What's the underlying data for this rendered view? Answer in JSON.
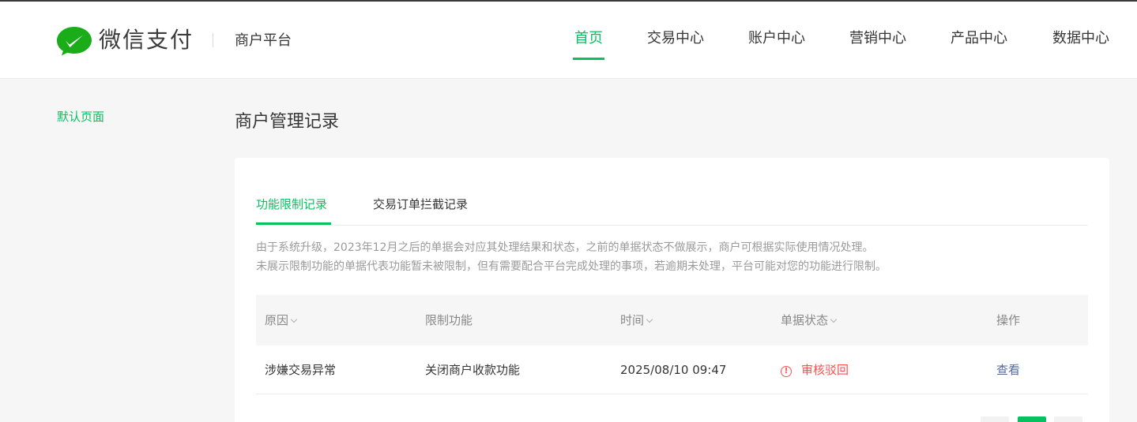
{
  "header": {
    "brand": "微信支付",
    "platform": "商户平台",
    "nav": [
      {
        "label": "首页",
        "active": true
      },
      {
        "label": "交易中心",
        "active": false
      },
      {
        "label": "账户中心",
        "active": false
      },
      {
        "label": "营销中心",
        "active": false
      },
      {
        "label": "产品中心",
        "active": false
      },
      {
        "label": "数据中心",
        "active": false
      }
    ]
  },
  "sidebar": {
    "link": "默认页面"
  },
  "page": {
    "title": "商户管理记录"
  },
  "tabs": [
    {
      "label": "功能限制记录",
      "active": true
    },
    {
      "label": "交易订单拦截记录",
      "active": false
    }
  ],
  "notice": {
    "line1": "由于系统升级，2023年12月之后的单据会对应其处理结果和状态，之前的单据状态不做展示，商户可根据实际使用情况处理。",
    "line2": "未展示限制功能的单据代表功能暂未被限制，但有需要配合平台完成处理的事项，若逾期未处理，平台可能对您的功能进行限制。"
  },
  "table": {
    "headers": [
      "原因",
      "限制功能",
      "时间",
      "单据状态",
      "操作"
    ],
    "rows": [
      {
        "reason": "涉嫌交易异常",
        "function": "关闭商户收款功能",
        "time": "2025/08/10 09:47",
        "status": "审核驳回",
        "status_icon": "!",
        "action": "查看"
      }
    ]
  },
  "colors": {
    "accent": "#07c160",
    "error": "#fa5151",
    "link": "#576b95"
  },
  "pagination": {
    "active_page_index": 1
  }
}
